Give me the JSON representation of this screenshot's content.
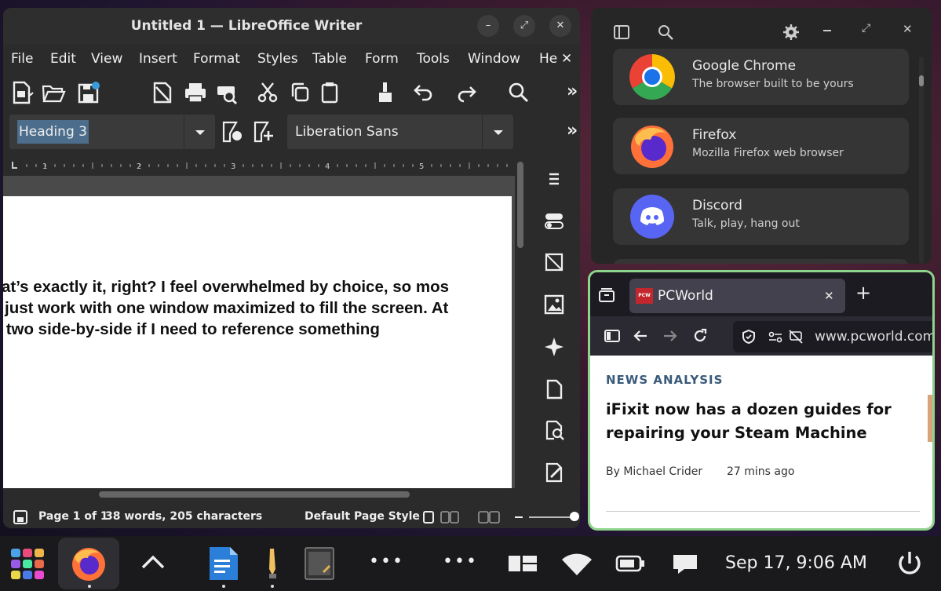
{
  "writer": {
    "title": "Untitled 1 — LibreOffice Writer",
    "menu": [
      "File",
      "Edit",
      "View",
      "Insert",
      "Format",
      "Styles",
      "Table",
      "Form",
      "Tools",
      "Window",
      "He"
    ],
    "menu_close": "✕",
    "overflow": "»",
    "paragraph_style": "Heading 3",
    "font_name": "Liberation Sans",
    "ruler_numbers": [
      "1",
      "2",
      "3",
      "4",
      "5"
    ],
    "doc_lines": [
      "at’s exactly it, right? I feel overwhelmed by choice, so mos",
      "just work with one window maximized to fill the screen. At",
      " two side-by-side if I need to reference something"
    ],
    "status": {
      "page": "Page 1 of 1",
      "words": "38 words, 205 characters",
      "page_style": "Default Page Style"
    }
  },
  "launcher": {
    "apps": [
      {
        "name": "Google Chrome",
        "desc": "The browser built to be yours",
        "icon": "chrome-icon"
      },
      {
        "name": "Firefox",
        "desc": "Mozilla Firefox web browser",
        "icon": "firefox-icon"
      },
      {
        "name": "Discord",
        "desc": "Talk, play, hang out",
        "icon": "discord-icon"
      }
    ]
  },
  "browser": {
    "tab_title": "PCWorld",
    "favicon_text": "PCW",
    "url": "www.pcworld.com",
    "article": {
      "kicker": "NEWS ANALYSIS",
      "headline_line1": "iFixit now has a dozen guides for",
      "headline_line2": "repairing your Steam Machine",
      "author": "By Michael Crider",
      "time": "27 mins ago"
    }
  },
  "taskbar": {
    "clock": "Sep 17, 9:06 AM",
    "accent": "#8fd48c"
  }
}
